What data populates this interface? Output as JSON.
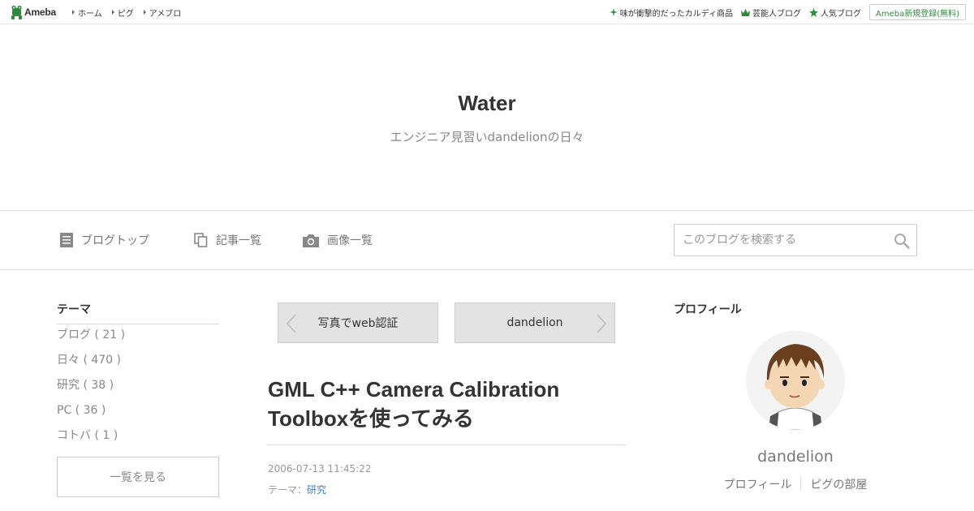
{
  "topbar": {
    "logo_text": "Ameba",
    "left_links": [
      "ホーム",
      "ピグ",
      "アメブロ"
    ],
    "right_links": [
      {
        "icon": "sparkle-icon",
        "label": "味が衝撃的だったカルディ商品"
      },
      {
        "icon": "crown-icon",
        "label": "芸能人ブログ"
      },
      {
        "icon": "star-icon",
        "label": "人気ブログ"
      }
    ],
    "register_label": "Ameba新規登録(無料)",
    "accent_color": "#2d8c3c"
  },
  "header": {
    "title": "Water",
    "description": "エンジニア見習いdandelionの日々"
  },
  "blognav": {
    "items": [
      {
        "icon": "document-icon",
        "label": "ブログトップ"
      },
      {
        "icon": "copy-icon",
        "label": "記事一覧"
      },
      {
        "icon": "camera-icon",
        "label": "画像一覧"
      }
    ],
    "search_placeholder": "このブログを検索する"
  },
  "sidebar_left": {
    "heading": "テーマ",
    "themes": [
      "ブログ ( 21 )",
      "日々 ( 470 )",
      "研究 ( 38 )",
      "PC ( 36 )",
      "コトバ ( 1 )"
    ],
    "see_all_label": "一覧を見る"
  },
  "article": {
    "prev_label": "写真でweb認証",
    "next_label": "dandelion",
    "title_line1": "GML C++ Camera Calibration",
    "title_line2": "Toolboxを使ってみる",
    "date": "2006-07-13 11:45:22",
    "theme_prefix": "テーマ：",
    "theme_name": "研究",
    "link_color": "#3b7ec1"
  },
  "sidebar_right": {
    "heading": "プロフィール",
    "name": "dandelion",
    "links": [
      "プロフィール",
      "ピグの部屋"
    ]
  }
}
